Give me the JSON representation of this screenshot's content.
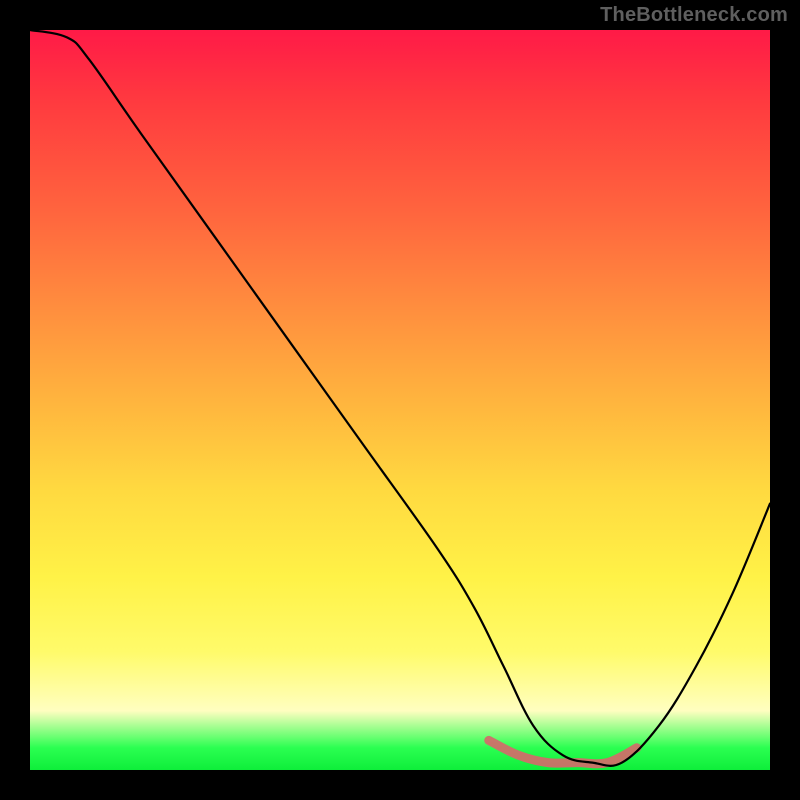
{
  "watermark": "TheBottleneck.com",
  "chart_data": {
    "type": "line",
    "title": "",
    "xlabel": "",
    "ylabel": "",
    "xlim": [
      0,
      100
    ],
    "ylim": [
      0,
      100
    ],
    "x": [
      0,
      5,
      8,
      15,
      25,
      35,
      45,
      55,
      60,
      64,
      68,
      72,
      76,
      80,
      85,
      90,
      95,
      100
    ],
    "values": [
      100,
      99,
      96,
      86,
      72,
      58,
      44,
      30,
      22,
      14,
      6,
      2,
      1,
      1,
      6,
      14,
      24,
      36
    ],
    "valley_x": [
      62,
      66,
      70,
      74,
      78,
      82
    ],
    "valley_values": [
      4,
      2,
      1,
      1,
      1,
      3
    ],
    "grid": false,
    "annotations": []
  }
}
